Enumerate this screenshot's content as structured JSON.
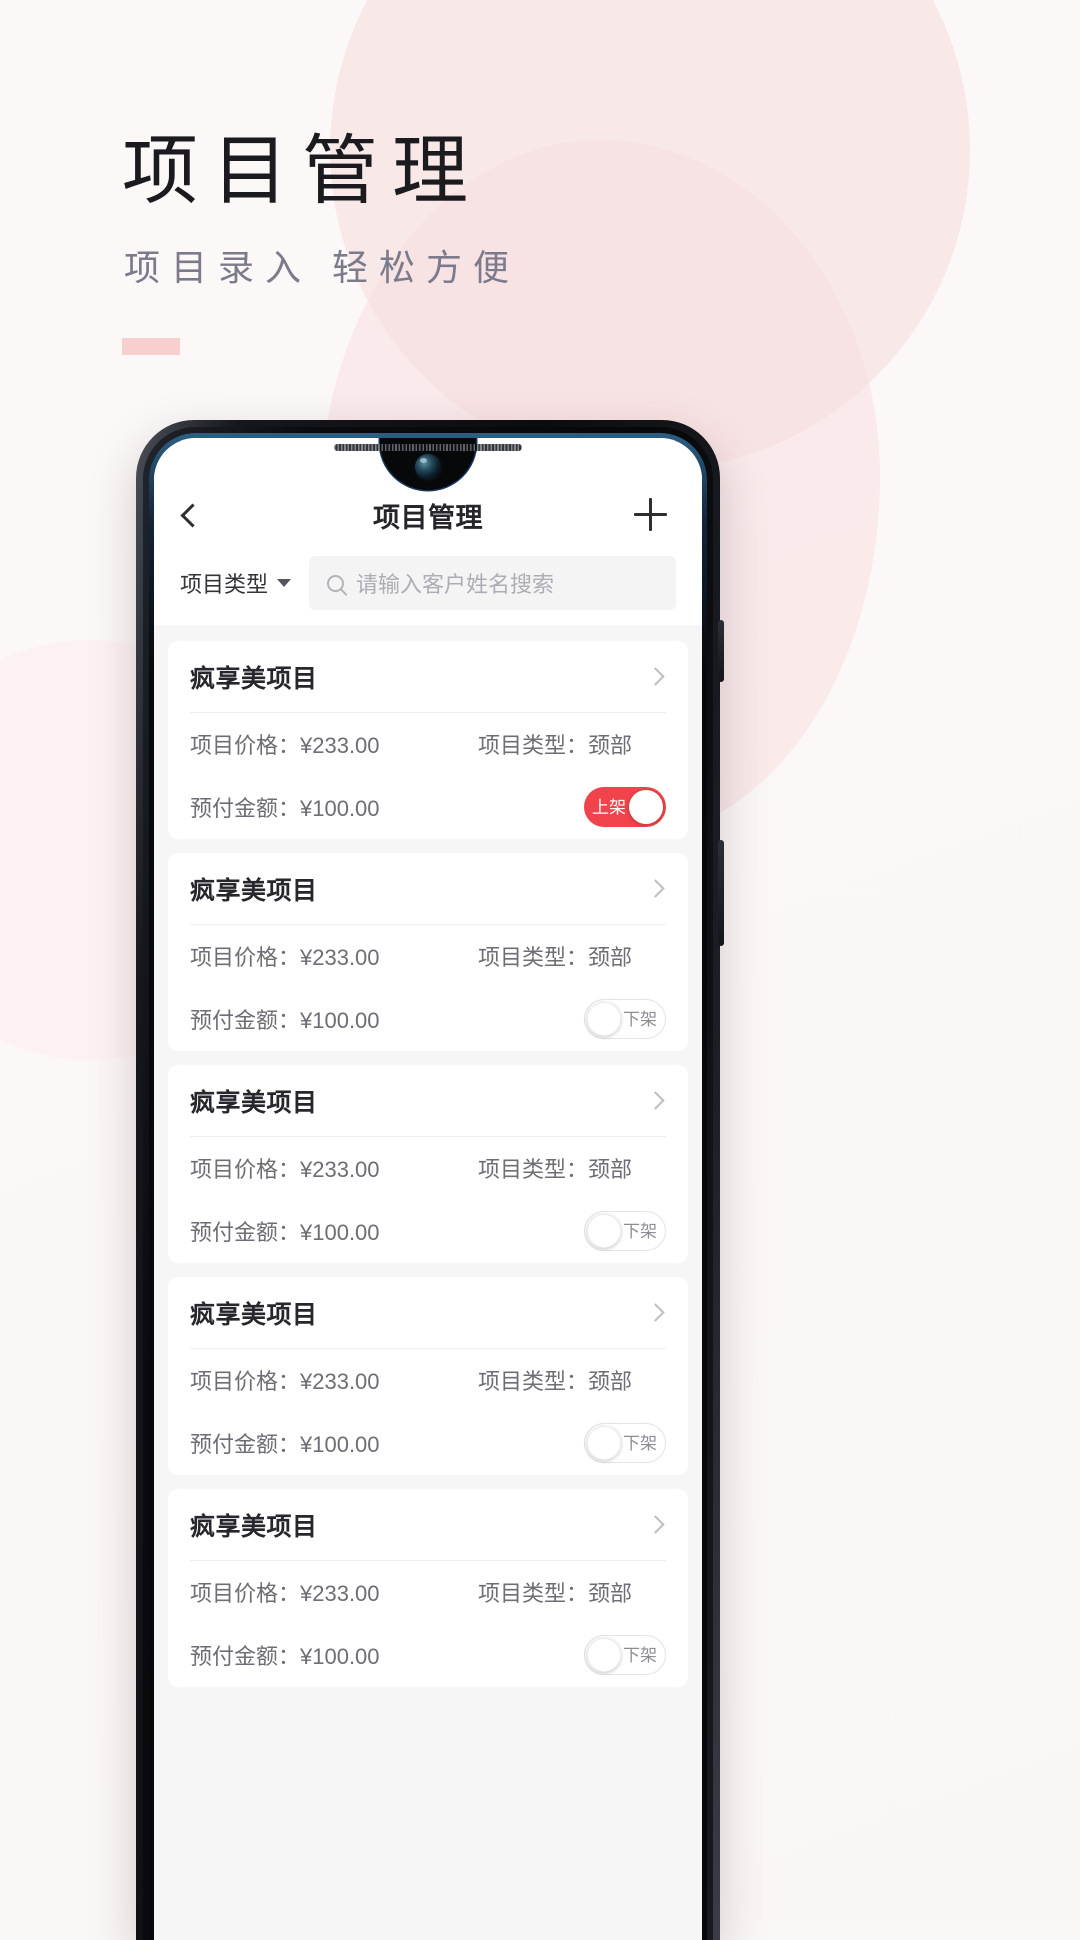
{
  "hero": {
    "title": "项目管理",
    "subtitle": "项目录入  轻松方便",
    "accent_color": "#f7cfcf"
  },
  "phone": {
    "appbar": {
      "back_icon": "chevron-left-icon",
      "title": "项目管理",
      "add_icon": "plus-icon"
    },
    "filter": {
      "type_label": "项目类型",
      "caret_icon": "chevron-down-icon",
      "search_icon": "search-icon",
      "search_placeholder": "请输入客户姓名搜索",
      "search_value": ""
    },
    "labels": {
      "price_label": "项目价格：",
      "deposit_label": "预付金额：",
      "type_label": "项目类型：",
      "chevron_icon": "chevron-right-icon"
    },
    "toggle": {
      "on_text": "上架",
      "off_text": "下架",
      "on_color": "#f0434b",
      "off_color": "#ffffff"
    },
    "cards": [
      {
        "title": "疯享美项目",
        "price": "项目价格：¥233.00",
        "type": "项目类型：颈部",
        "deposit": "预付金额：¥100.00",
        "status": "上架",
        "on": true
      },
      {
        "title": "疯享美项目",
        "price": "项目价格：¥233.00",
        "type": "项目类型：颈部",
        "deposit": "预付金额：¥100.00",
        "status": "下架",
        "on": false
      },
      {
        "title": "疯享美项目",
        "price": "项目价格：¥233.00",
        "type": "项目类型：颈部",
        "deposit": "预付金额：¥100.00",
        "status": "下架",
        "on": false
      },
      {
        "title": "疯享美项目",
        "price": "项目价格：¥233.00",
        "type": "项目类型：颈部",
        "deposit": "预付金额：¥100.00",
        "status": "下架",
        "on": false
      },
      {
        "title": "疯享美项目",
        "price": "项目价格：¥233.00",
        "type": "项目类型：颈部",
        "deposit": "预付金额：¥100.00",
        "status": "下架",
        "on": false
      }
    ]
  }
}
